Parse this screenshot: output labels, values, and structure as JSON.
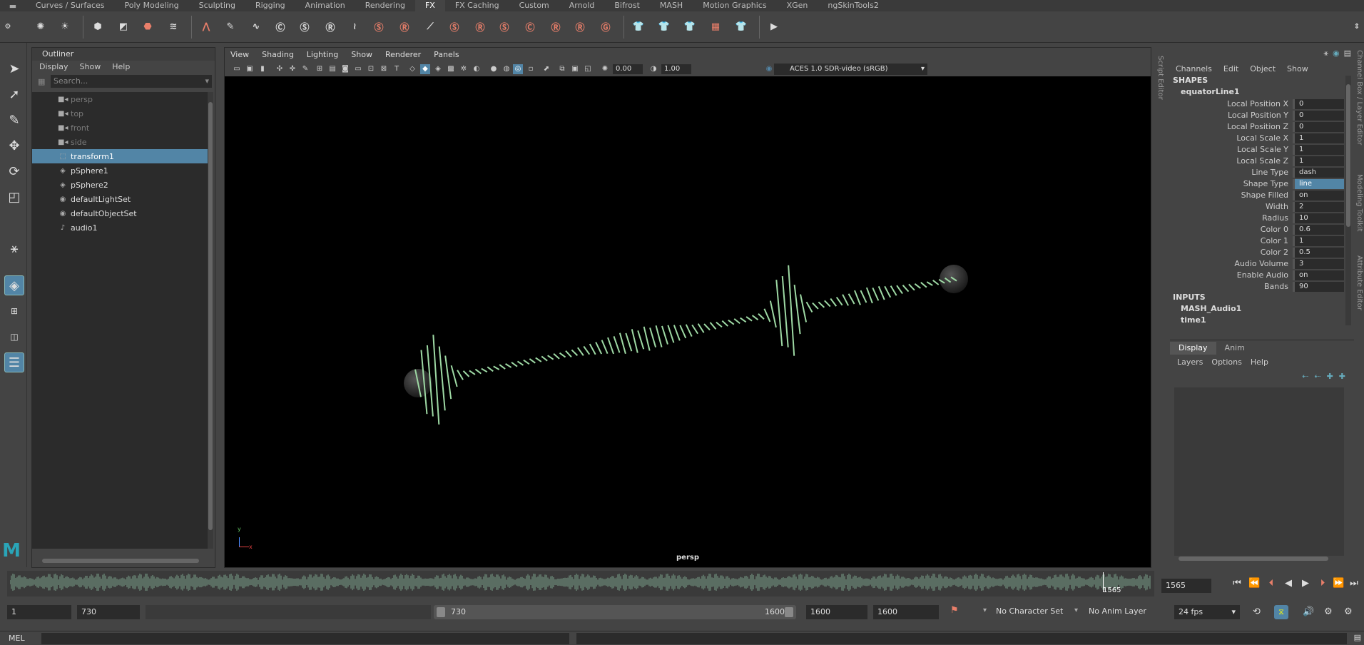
{
  "shelf_tabs": [
    "Curves / Surfaces",
    "Poly Modeling",
    "Sculpting",
    "Rigging",
    "Animation",
    "Rendering",
    "FX",
    "FX Caching",
    "Custom",
    "Arnold",
    "Bifrost",
    "MASH",
    "Motion Graphics",
    "XGen",
    "ngSkinTools2"
  ],
  "active_shelf_tab": "FX",
  "outliner": {
    "title": "Outliner",
    "menu": [
      "Display",
      "Show",
      "Help"
    ],
    "search_placeholder": "Search...",
    "items": [
      {
        "label": "persp",
        "icon": "camera-icon",
        "dim": true,
        "selected": false
      },
      {
        "label": "top",
        "icon": "camera-icon",
        "dim": true,
        "selected": false
      },
      {
        "label": "front",
        "icon": "camera-icon",
        "dim": true,
        "selected": false
      },
      {
        "label": "side",
        "icon": "camera-icon",
        "dim": true,
        "selected": false
      },
      {
        "label": "transform1",
        "icon": "transform-icon",
        "dim": false,
        "selected": true
      },
      {
        "label": "pSphere1",
        "icon": "mesh-icon",
        "dim": false,
        "selected": false
      },
      {
        "label": "pSphere2",
        "icon": "mesh-icon",
        "dim": false,
        "selected": false
      },
      {
        "label": "defaultLightSet",
        "icon": "set-icon",
        "dim": false,
        "selected": false
      },
      {
        "label": "defaultObjectSet",
        "icon": "set-icon",
        "dim": false,
        "selected": false
      },
      {
        "label": "audio1",
        "icon": "audio-icon",
        "dim": false,
        "selected": false
      }
    ]
  },
  "viewport": {
    "menu": [
      "View",
      "Shading",
      "Lighting",
      "Show",
      "Renderer",
      "Panels"
    ],
    "exposure": "0.00",
    "gamma": "1.00",
    "color_space": "ACES 1.0 SDR-video (sRGB)",
    "camera_label": "persp",
    "axis_y": "y",
    "axis_x": "x"
  },
  "script_editor_label": "Script Editor",
  "side_labels": [
    "Channel Box / Layer Editor",
    "Modeling Toolkit",
    "Attribute Editor"
  ],
  "channel_box": {
    "menu": [
      "Channels",
      "Edit",
      "Object",
      "Show"
    ],
    "shapes_header": "SHAPES",
    "shape_node": "equatorLine1",
    "attributes": [
      {
        "label": "Local Position X",
        "value": "0",
        "selected": false
      },
      {
        "label": "Local Position Y",
        "value": "0",
        "selected": false
      },
      {
        "label": "Local Position Z",
        "value": "0",
        "selected": false
      },
      {
        "label": "Local Scale X",
        "value": "1",
        "selected": false
      },
      {
        "label": "Local Scale Y",
        "value": "1",
        "selected": false
      },
      {
        "label": "Local Scale Z",
        "value": "1",
        "selected": false
      },
      {
        "label": "Line Type",
        "value": "dash",
        "selected": false
      },
      {
        "label": "Shape Type",
        "value": "line",
        "selected": true
      },
      {
        "label": "Shape Filled",
        "value": "on",
        "selected": false
      },
      {
        "label": "Width",
        "value": "2",
        "selected": false
      },
      {
        "label": "Radius",
        "value": "10",
        "selected": false
      },
      {
        "label": "Color 0",
        "value": "0.6",
        "selected": false
      },
      {
        "label": "Color 1",
        "value": "1",
        "selected": false
      },
      {
        "label": "Color 2",
        "value": "0.5",
        "selected": false
      },
      {
        "label": "Audio Volume",
        "value": "3",
        "selected": false
      },
      {
        "label": "Enable Audio",
        "value": "on",
        "selected": false
      },
      {
        "label": "Bands",
        "value": "90",
        "selected": false
      }
    ],
    "inputs_header": "INPUTS",
    "inputs": [
      "MASH_Audio1",
      "time1"
    ]
  },
  "layer_editor": {
    "tabs": [
      "Display",
      "Anim"
    ],
    "active_tab": "Display",
    "menu": [
      "Layers",
      "Options",
      "Help"
    ]
  },
  "time_slider": {
    "current_frame_marker": "1565",
    "current_frame": "1565",
    "range_start": "1",
    "playback_start": "730",
    "slider_start": "730",
    "slider_end": "1600",
    "playback_end": "1600",
    "range_end": "1600",
    "character_set": "No Character Set",
    "anim_layer": "No Anim Layer",
    "fps": "24 fps"
  },
  "command_line": {
    "language": "MEL"
  },
  "colors": {
    "selection": "#5285a6",
    "shelf_accent": "#ea7f6a",
    "waveform": "#7aa08a",
    "equalizer_bars": "#9ed9a4",
    "maya_logo": "#2aa5b8"
  }
}
